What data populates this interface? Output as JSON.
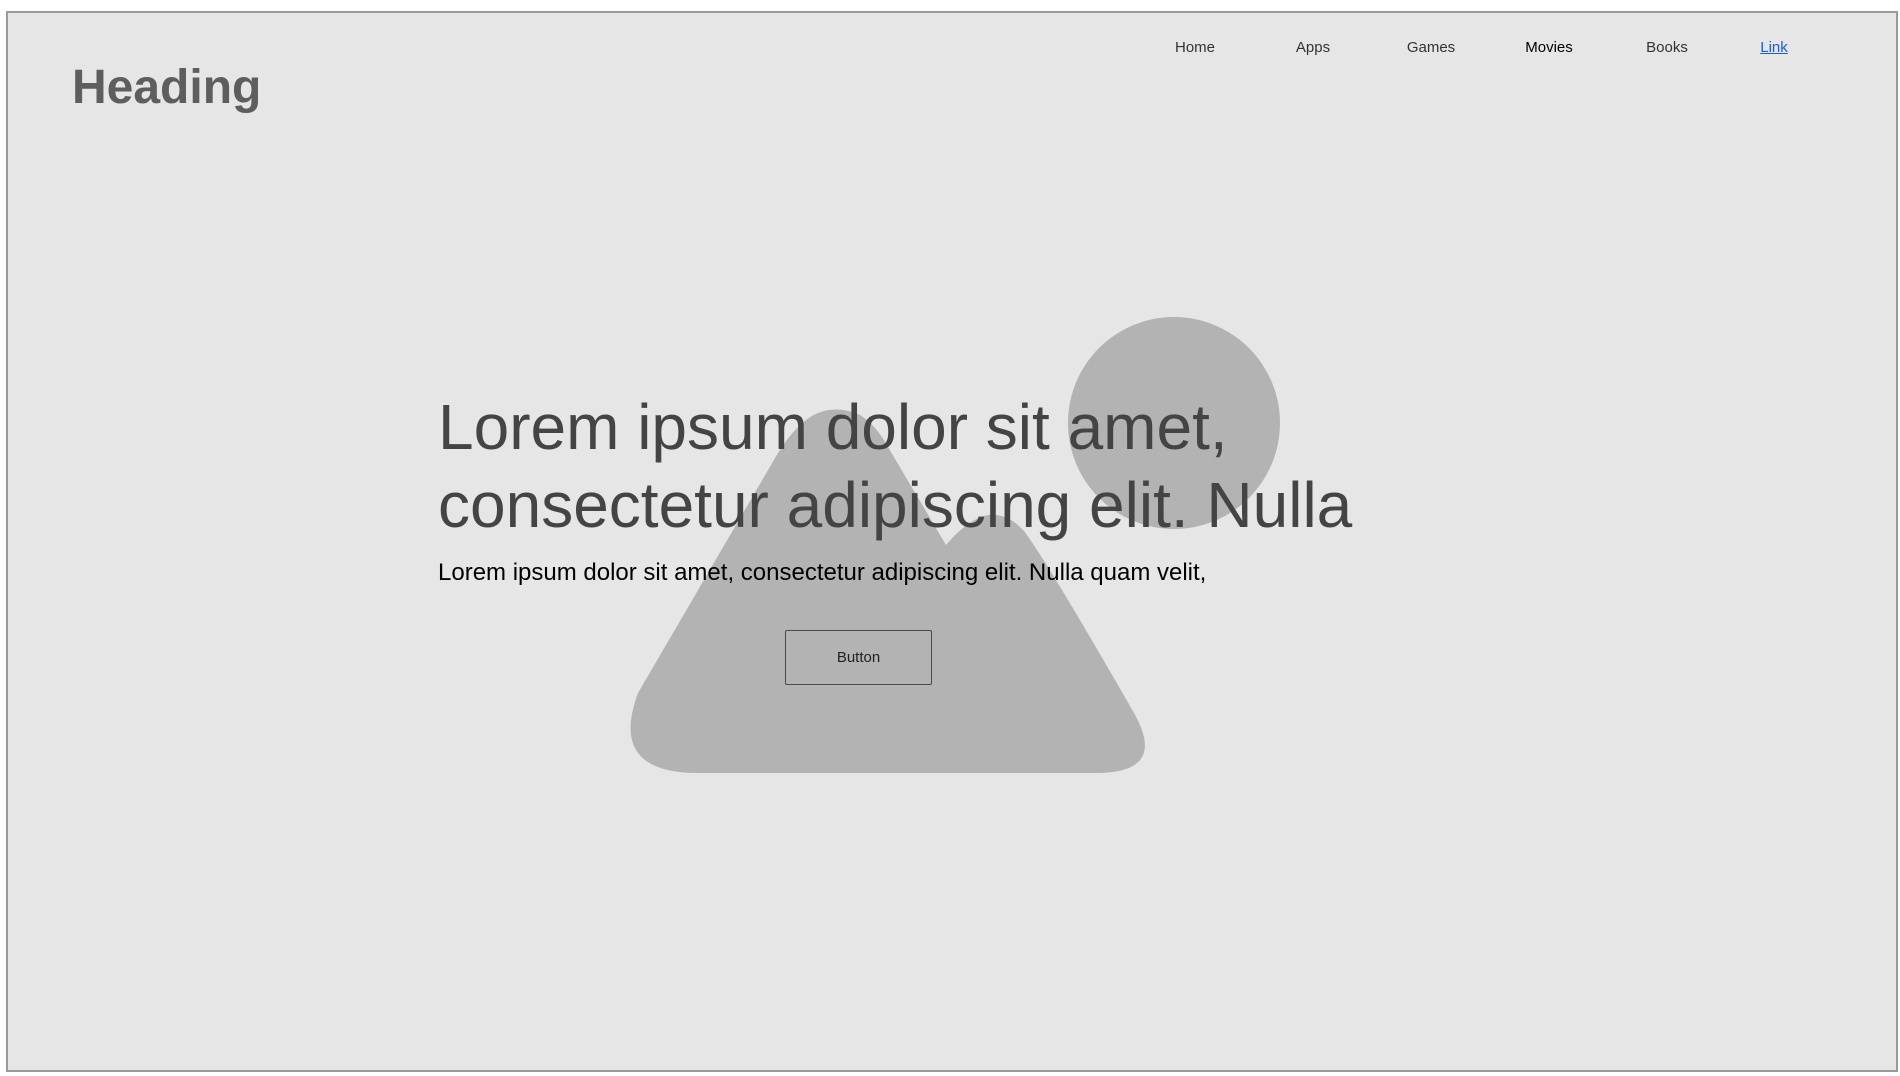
{
  "header": {
    "heading": "Heading"
  },
  "nav": {
    "items": [
      {
        "label": "Home"
      },
      {
        "label": "Apps"
      },
      {
        "label": "Games"
      },
      {
        "label": "Movies"
      },
      {
        "label": "Books"
      },
      {
        "label": "Link"
      }
    ],
    "active": "Movies",
    "link_color": "#1a5fd0"
  },
  "hero": {
    "title": "Lorem ipsum dolor sit amet, consectetur adipiscing elit. Nulla quam",
    "text": "Lorem ipsum dolor sit amet, consectetur adipiscing elit. Nulla quam velit,",
    "button_label": "Button",
    "image_icon": "image-placeholder-icon"
  },
  "colors": {
    "background": "#e6e6e6",
    "placeholder_shape": "#b3b3b3",
    "heading": "#5e5e5e",
    "hero_title": "#444444"
  }
}
